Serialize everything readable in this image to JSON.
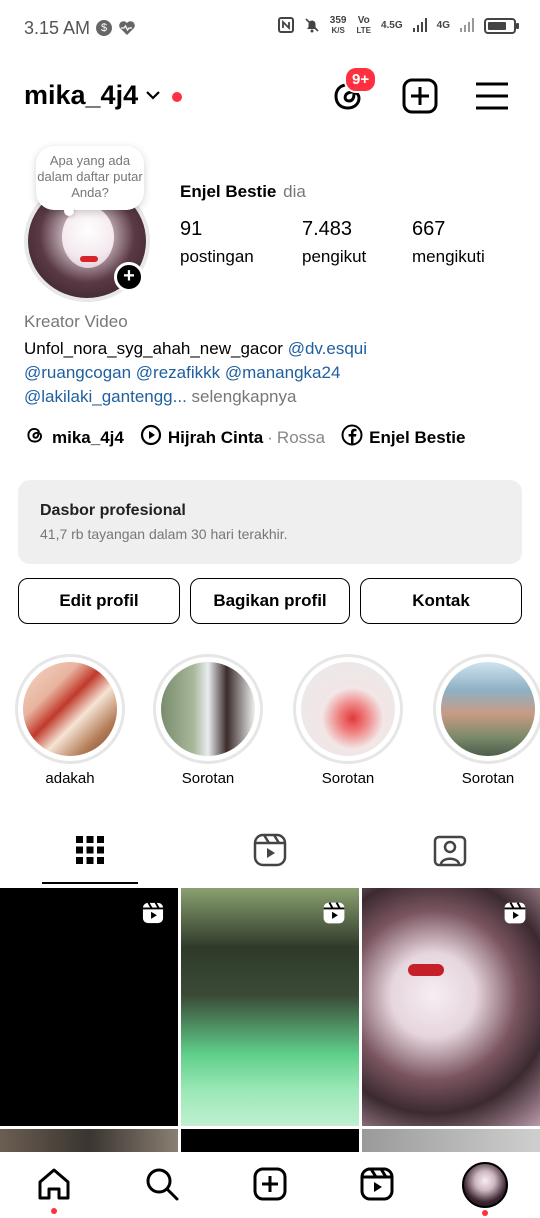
{
  "status_bar": {
    "time": "3.15 AM",
    "data_speed_value": "359",
    "data_speed_unit": "K/S",
    "volte_line1": "Vo",
    "volte_line2": "LTE",
    "network_5g": "4.5G",
    "network_4g": "4G"
  },
  "header": {
    "username": "mika_4j4",
    "notification_badge": "9+"
  },
  "profile": {
    "note_text": "Apa yang ada dalam daftar putar Anda?",
    "display_name": "Enjel Bestie",
    "pronoun": "dia",
    "stats": [
      {
        "value": "91",
        "label": "postingan"
      },
      {
        "value": "7.483",
        "label": "pengikut"
      },
      {
        "value": "667",
        "label": "mengikuti"
      }
    ],
    "category": "Kreator Video",
    "bio_text": "Unfol_nora_syg_ahah_new_gacor",
    "bio_mentions": [
      "@dv.esqui",
      "@ruangcogan",
      "@rezafikkk",
      "@manangka24",
      "@lakilaki_gantengg..."
    ],
    "bio_more": "selengkapnya",
    "links": {
      "threads": "mika_4j4",
      "music_title": "Hijrah Cinta",
      "music_artist": "Rossa",
      "facebook": "Enjel Bestie"
    }
  },
  "dashboard": {
    "title": "Dasbor profesional",
    "subtitle": "41,7 rb tayangan dalam 30 hari terakhir."
  },
  "buttons": {
    "edit": "Edit profil",
    "share": "Bagikan profil",
    "contact": "Kontak"
  },
  "highlights": [
    {
      "label": "adakah"
    },
    {
      "label": "Sorotan"
    },
    {
      "label": "Sorotan"
    },
    {
      "label": "Sorotan"
    }
  ],
  "colors": {
    "accent_red": "#ff3040",
    "link_blue": "#1f5f9e",
    "muted_text": "#777777"
  },
  "icons": {
    "threads": "threads-icon",
    "new_post": "plus-square-icon",
    "menu": "hamburger-menu-icon",
    "grid_tab": "grid-icon",
    "reels_tab": "reels-icon",
    "tagged_tab": "tagged-person-icon",
    "nav": [
      "home-icon",
      "search-icon",
      "create-icon",
      "reels-icon",
      "profile-avatar"
    ]
  }
}
